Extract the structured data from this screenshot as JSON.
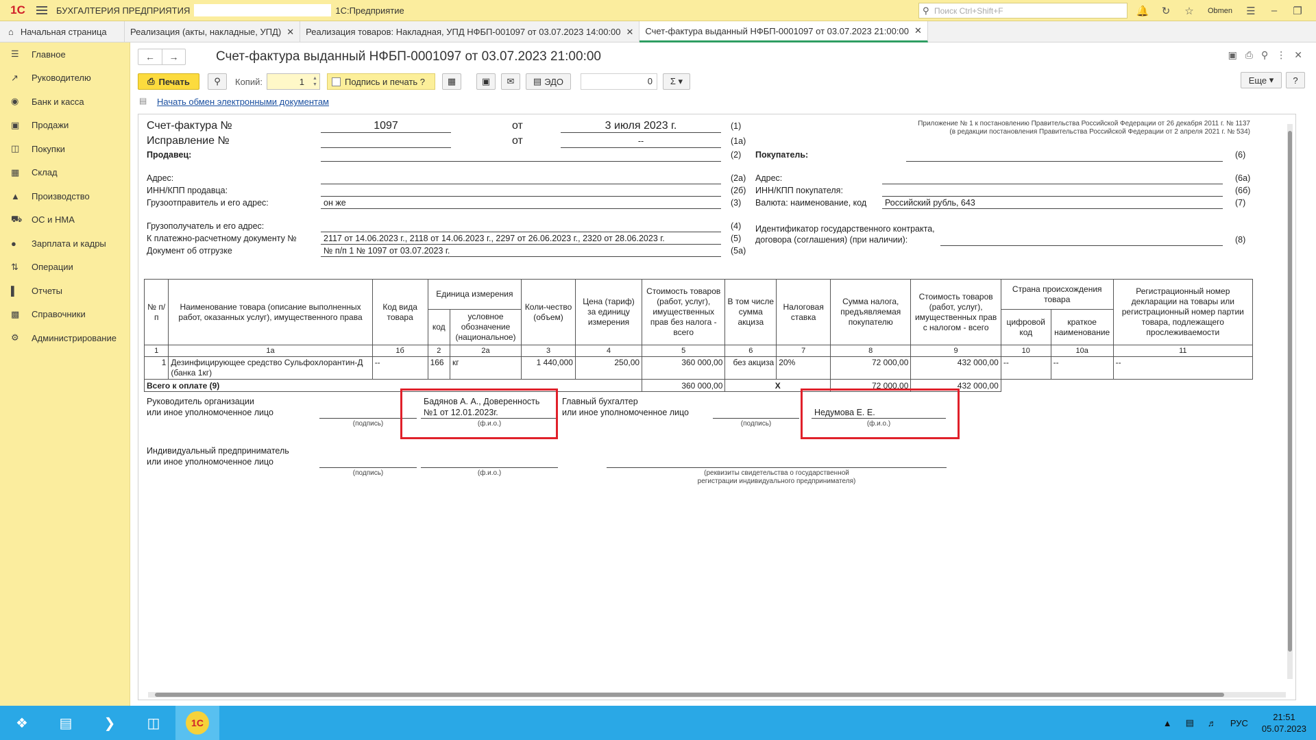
{
  "titlebar": {
    "app_name": "БУХГАЛТЕРИЯ ПРЕДПРИЯТИЯ",
    "app_suffix": "1С:Предприятие",
    "search_placeholder": "Поиск Ctrl+Shift+F",
    "user": "Obmen"
  },
  "tabs": [
    {
      "label": "Начальная страница"
    },
    {
      "label": "Реализация (акты, накладные, УПД)"
    },
    {
      "label": "Реализация товаров: Накладная, УПД НФБП-001097 от 03.07.2023 14:00:00"
    },
    {
      "label": "Счет-фактура выданный НФБП-0001097 от 03.07.2023 21:00:00"
    }
  ],
  "sidebar": {
    "items": [
      {
        "label": "Главное",
        "icon": "menu-icon"
      },
      {
        "label": "Руководителю",
        "icon": "chart-icon"
      },
      {
        "label": "Банк и касса",
        "icon": "bank-icon"
      },
      {
        "label": "Продажи",
        "icon": "bag-icon"
      },
      {
        "label": "Покупки",
        "icon": "cart-icon"
      },
      {
        "label": "Склад",
        "icon": "warehouse-icon"
      },
      {
        "label": "Производство",
        "icon": "factory-icon"
      },
      {
        "label": "ОС и НМА",
        "icon": "truck-icon"
      },
      {
        "label": "Зарплата и кадры",
        "icon": "person-icon"
      },
      {
        "label": "Операции",
        "icon": "operations-icon"
      },
      {
        "label": "Отчеты",
        "icon": "bars-icon"
      },
      {
        "label": "Справочники",
        "icon": "book-icon"
      },
      {
        "label": "Администрирование",
        "icon": "gear-icon"
      }
    ]
  },
  "doc": {
    "title": "Счет-фактура выданный НФБП-0001097 от 03.07.2023 21:00:00",
    "print_label": "Печать",
    "copies_label": "Копий:",
    "copies_value": "1",
    "sign_print_label": "Подпись и печать ?",
    "edo_label": "ЭДО",
    "sum_value": "0",
    "more_label": "Еще",
    "help_label": "?",
    "edo_link": "Начать обмен электронными документам"
  },
  "invoice": {
    "appendix_line1": "Приложение № 1 к постановлению Правительства Российской Федерации от 26 декабря 2011 г. № 1137",
    "appendix_line2": "(в редакции постановления Правительства Российской Федерации от 2 апреля 2021 г. № 534)",
    "sf_label": "Счет-фактура №",
    "sf_number": "1097",
    "ot": "от",
    "sf_date": "3 июля 2023 г.",
    "correction_label": "Исправление №",
    "correction_date": "--",
    "seller_label": "Продавец:",
    "address_label": "Адрес:",
    "inn_seller_label": "ИНН/КПП продавца:",
    "shipper_label": "Грузоотправитель и его адрес:",
    "shipper_value": "он же",
    "consignee_label": "Грузополучатель и его адрес:",
    "payment_doc_label": "К платежно-расчетному документу №",
    "payment_doc_value": "2117 от 14.06.2023 г., 2118 от 14.06.2023 г., 2297 от 26.06.2023 г., 2320 от 28.06.2023 г.",
    "shipment_doc_label": "Документ об отгрузке",
    "shipment_doc_value": "№ п/п 1 № 1097 от 03.07.2023 г.",
    "buyer_label": "Покупатель:",
    "buyer_address_label": "Адрес:",
    "inn_buyer_label": "ИНН/КПП покупателя:",
    "currency_label": "Валюта: наименование, код",
    "currency_value": "Российский рубль, 643",
    "contract_label1": "Идентификатор государственного контракта,",
    "contract_label2": "договора (соглашения) (при наличии):",
    "codes": {
      "c1": "(1)",
      "c1a": "(1а)",
      "c2": "(2)",
      "c2a": "(2а)",
      "c2b": "(2б)",
      "c3": "(3)",
      "c4": "(4)",
      "c5": "(5)",
      "c5a": "(5а)",
      "c6": "(6)",
      "c6a": "(6а)",
      "c6b": "(6б)",
      "c7": "(7)",
      "c8": "(8)"
    },
    "headers": {
      "num": "№ п/п",
      "name": "Наименование товара (описание выполненных работ, оказанных услуг), имущественного права",
      "kind_code": "Код вида товара",
      "unit": "Единица измерения",
      "unit_code": "код",
      "unit_name": "условное обозначение (национальное)",
      "qty": "Коли-чество (объем)",
      "price": "Цена (тариф) за единицу измерения",
      "cost_no_tax": "Стоимость товаров (работ, услуг), имущественных прав без налога - всего",
      "excise": "В том числе сумма акциза",
      "tax_rate": "Налоговая ставка",
      "tax_sum": "Сумма налога, предъявляемая покупателю",
      "cost_with_tax": "Стоимость товаров (работ, услуг), имущественных прав с налогом - всего",
      "country": "Страна происхождения товара",
      "country_code": "цифровой код",
      "country_name": "краткое наименование",
      "reg_number": "Регистрационный номер декларации на товары или регистрационный номер партии товара, подлежащего прослеживаемости"
    },
    "col_numbers": [
      "1",
      "1а",
      "1б",
      "2",
      "2а",
      "3",
      "4",
      "5",
      "6",
      "7",
      "8",
      "9",
      "10",
      "10а",
      "11"
    ],
    "row": {
      "n": "1",
      "name": "Дезинфицирующее средство Сульфохлорантин-Д (банка 1кг)",
      "kind_code": "--",
      "unit_code": "166",
      "unit_name": "кг",
      "qty": "1 440,000",
      "price": "250,00",
      "cost_no_tax": "360 000,00",
      "excise": "без акциза",
      "tax_rate": "20%",
      "tax_sum": "72 000,00",
      "cost_with_tax": "432 000,00",
      "country_code": "--",
      "country_name": "--",
      "reg_number": "--"
    },
    "total": {
      "label": "Всего к оплате (9)",
      "cost_no_tax": "360 000,00",
      "excise": "Х",
      "tax_sum": "72 000,00",
      "cost_with_tax": "432 000,00"
    },
    "signatures": {
      "head_label1": "Руководитель организации",
      "head_label2": "или иное уполномоченное лицо",
      "head_name1": "Бадянов А. А., Доверенность",
      "head_name2": "№1 от 12.01.2023г.",
      "chief_label1": "Главный бухгалтер",
      "chief_label2": "или иное уполномоченное лицо",
      "chief_name": "Недумова Е. Е.",
      "ip_label1": "Индивидуальный предприниматель",
      "ip_label2": "или иное уполномоченное лицо",
      "sign_caption": "(подпись)",
      "fio_caption": "(ф.и.о.)",
      "ip_caption1": "(реквизиты свидетельства о государственной",
      "ip_caption2": "регистрации индивидуального предпринимателя)"
    }
  },
  "taskbar": {
    "lang": "РУС",
    "time": "21:51",
    "date": "05.07.2023"
  },
  "colors": {
    "accent_yellow": "#fbed9e",
    "primary_button": "#fcdb3e",
    "active_tab": "#2f9e62",
    "highlight_red": "#e0202a",
    "taskbar": "#2aa8e6"
  }
}
